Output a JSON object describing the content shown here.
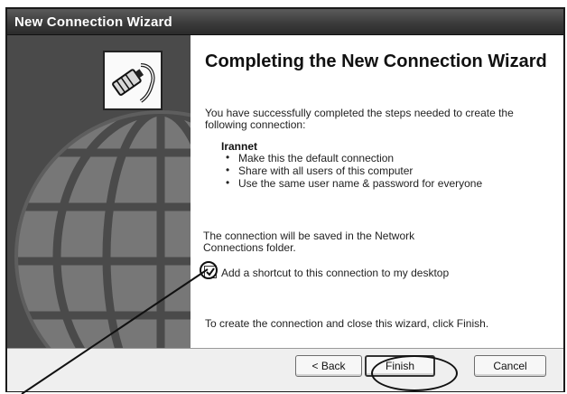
{
  "window": {
    "title": "New Connection Wizard"
  },
  "sidebar": {
    "image": "globe-watermark",
    "icon": "connection-plug-icon"
  },
  "content": {
    "heading": "Completing the New Connection Wizard",
    "intro": "You have successfully completed the steps needed to create the following connection:",
    "connection_name": "Irannet",
    "options": [
      "Make this the default connection",
      "Share with all users of this computer",
      "Use the same user name & password for everyone"
    ],
    "saved_text": "The connection will be saved in the Network Connections folder.",
    "shortcut_checkbox": {
      "label": "Add a shortcut to this connection to my desktop",
      "checked": true
    },
    "finish_text": "To create the connection and close this wizard, click Finish."
  },
  "buttons": {
    "back": "< Back",
    "finish": "Finish",
    "cancel": "Cancel"
  },
  "annotations": {
    "highlighted": [
      "shortcut-checkbox",
      "finish-button"
    ]
  }
}
